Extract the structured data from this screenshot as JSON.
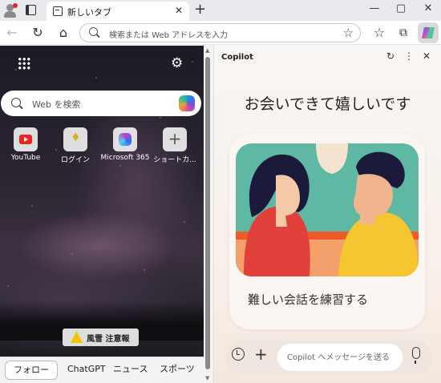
{
  "browser": {
    "tab": {
      "title": "新しいタブ",
      "close_glyph": "✕"
    },
    "new_tab_glyph": "+",
    "window_controls": {
      "minimize": "—",
      "maximize": "▢",
      "close": "✕"
    },
    "toolbar": {
      "back_glyph": "←",
      "refresh_glyph": "↻",
      "home_glyph": "⌂",
      "address_placeholder": "検索または Web アドレスを入力",
      "favorite_glyph": "☆",
      "collections_glyph": "☆"
    }
  },
  "new_tab_page": {
    "search_placeholder": "Web を検索",
    "settings_glyph": "⚙",
    "tiles": [
      {
        "label": "YouTube",
        "icon": "youtube-icon"
      },
      {
        "label": "ログイン",
        "icon": "login-icon"
      },
      {
        "label": "Microsoft 365",
        "icon": "microsoft365-icon"
      },
      {
        "label": "ショートカ...",
        "icon": "plus-icon"
      }
    ],
    "weather_alert": "風雪 注意報",
    "bottom_nav": [
      "フォロー",
      "ChatGPT",
      "ニュース",
      "スポーツ"
    ],
    "login_glyph": "♦"
  },
  "copilot": {
    "title": "Copilot",
    "refresh_glyph": "↻",
    "more_glyph": "⋮",
    "close_glyph": "✕",
    "heading": "お会いできて嬉しいです",
    "card_label": "難しい会話を練習する",
    "input_placeholder": "Copilot へメッセージを送る",
    "add_glyph": "+"
  },
  "colors": {
    "accent": "#2a7df4",
    "alert": "#f5c400"
  }
}
